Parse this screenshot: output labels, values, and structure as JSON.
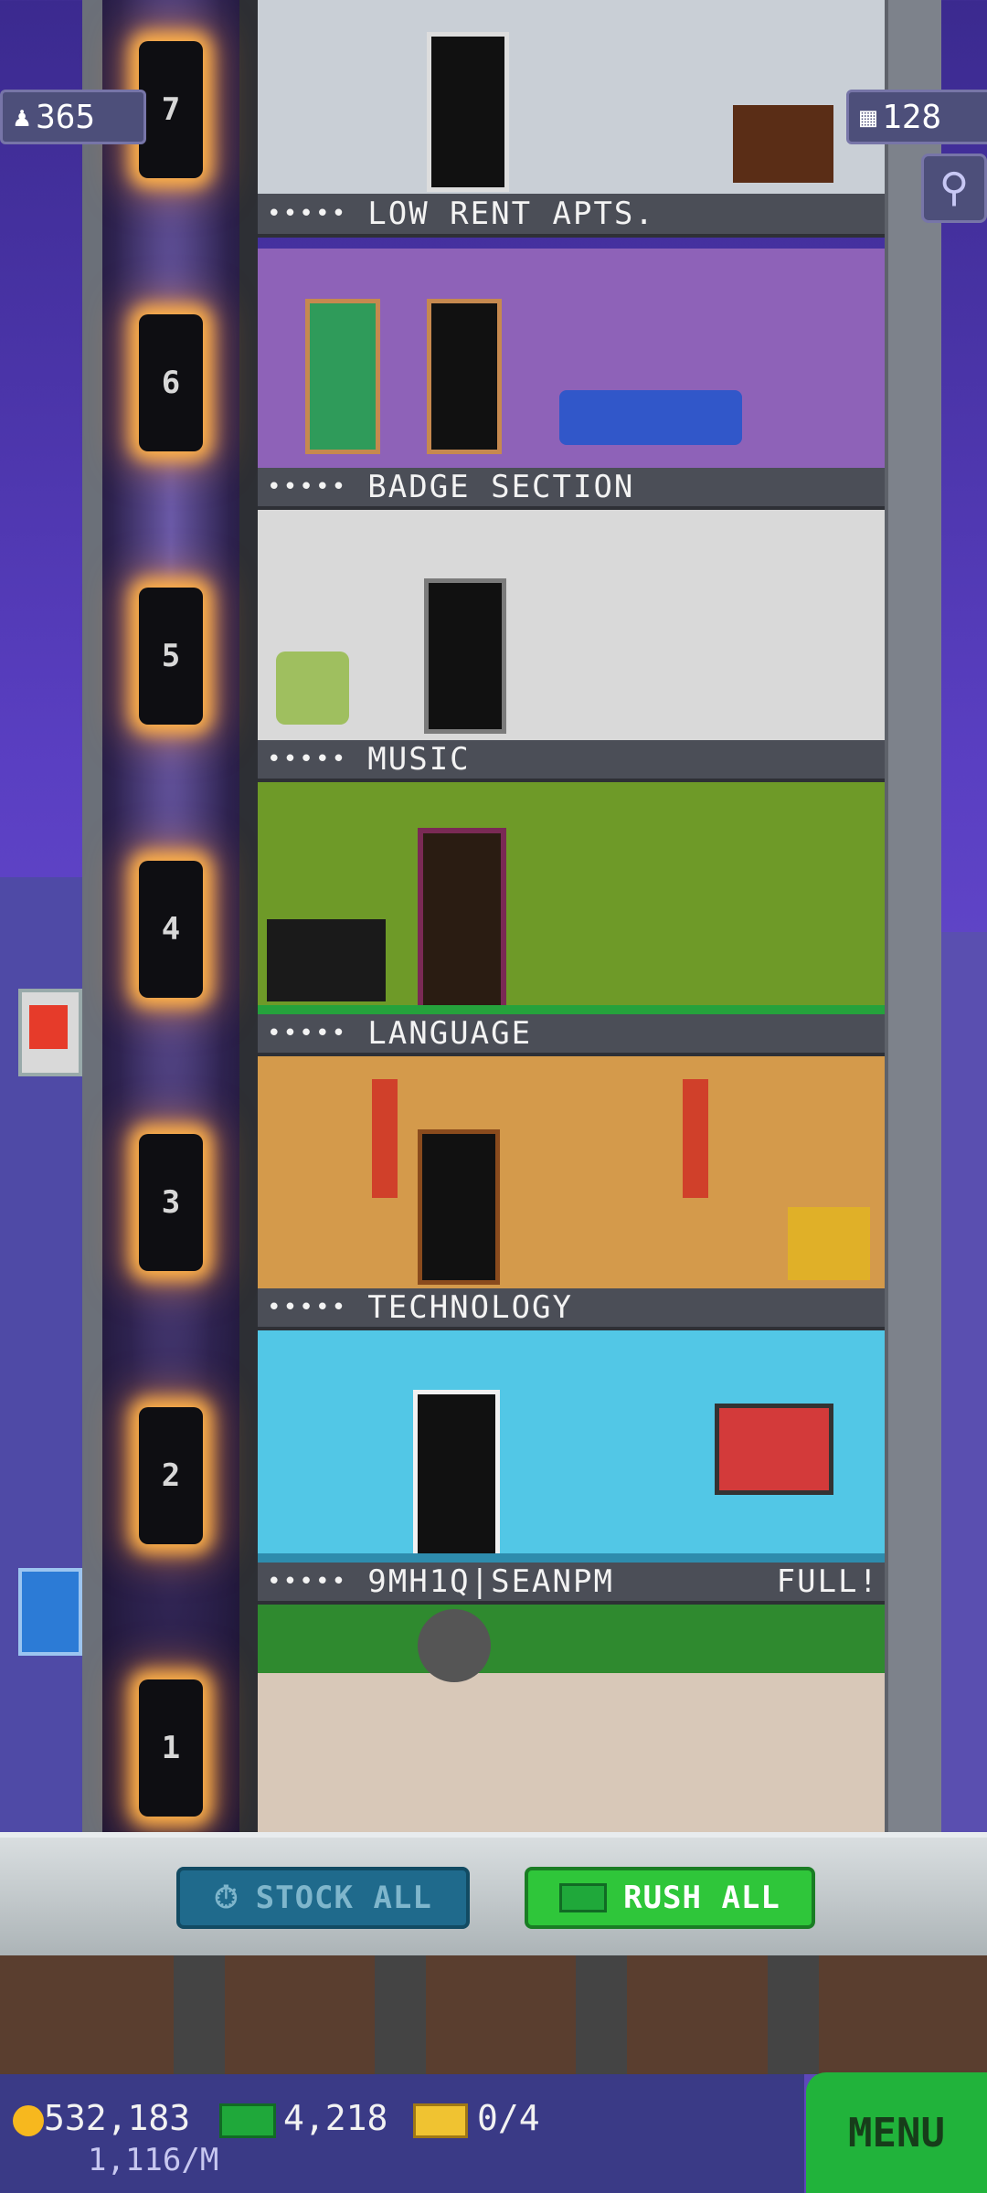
{
  "stats": {
    "population": "365",
    "floors": "128"
  },
  "floors": [
    {
      "number": "7",
      "name": "LOW RENT APTS.",
      "status": "",
      "room_color": "#c9cfd6"
    },
    {
      "number": "6",
      "name": "BADGE SECTION",
      "status": "",
      "room_color": "#8e62b8"
    },
    {
      "number": "5",
      "name": "MUSIC",
      "status": "",
      "room_color": "#d9d9d9"
    },
    {
      "number": "4",
      "name": "LANGUAGE",
      "status": "",
      "room_color": "#6e9a28"
    },
    {
      "number": "3",
      "name": "TECHNOLOGY",
      "status": "",
      "room_color": "#d49a4b"
    },
    {
      "number": "2",
      "name": "9MH1Q|SEANPM",
      "status": "FULL!",
      "room_color": "#52c7e6"
    },
    {
      "number": "1",
      "name": "",
      "status": "",
      "room_color": "#d8c8b8"
    }
  ],
  "rating_dots": "•••••",
  "actions": {
    "stock_all": "STOCK ALL",
    "rush_all": "RUSH ALL"
  },
  "hud": {
    "coins": "532,183",
    "coin_rate": "1,116/M",
    "bux": "4,218",
    "tickets": "0/4",
    "menu": "MENU"
  },
  "icons": [
    "person-icon",
    "building-icon",
    "search-icon",
    "clock-icon",
    "bux-icon",
    "coin-icon",
    "ticket-icon",
    "fries-icon",
    "chat-icon"
  ]
}
